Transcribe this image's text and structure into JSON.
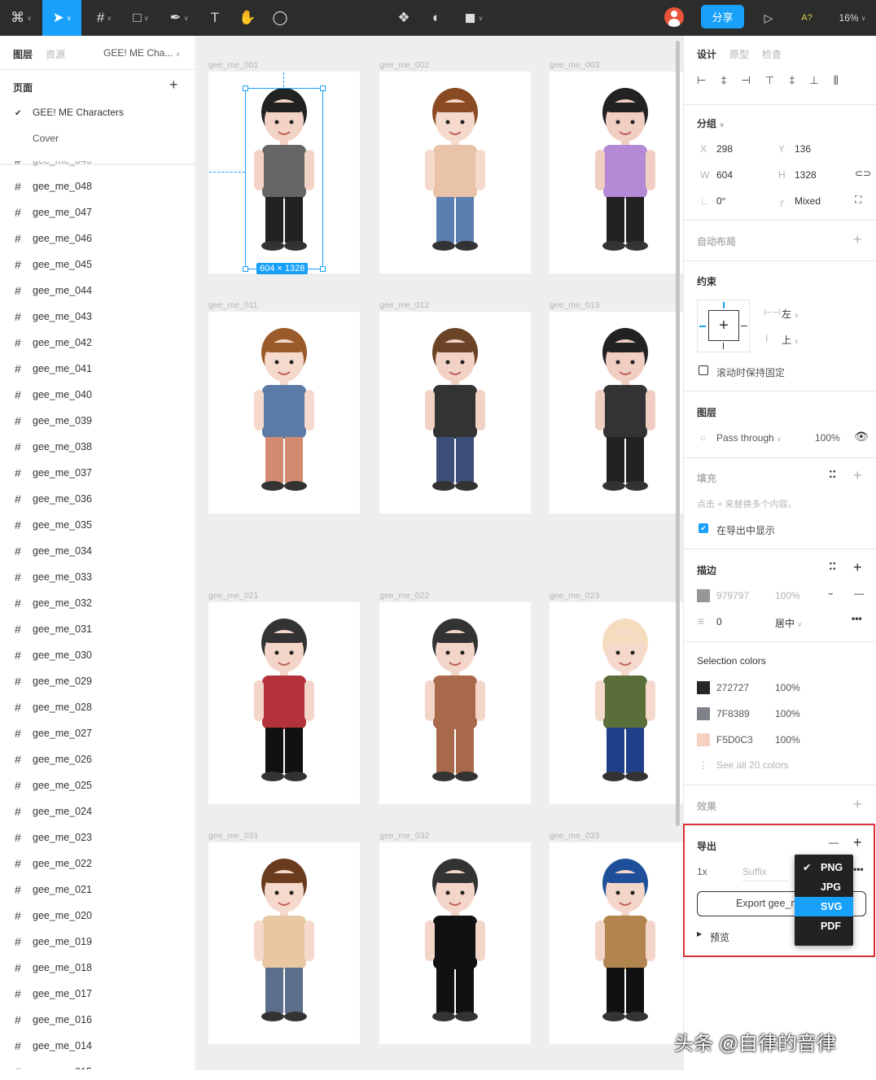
{
  "toolbar": {
    "zoom": "16%",
    "share": "分享",
    "font_warning": "A?",
    "icons": [
      "figma-menu-icon",
      "move-icon",
      "frame-icon",
      "rectangle-icon",
      "pen-icon",
      "text-icon",
      "hand-icon",
      "comment-icon",
      "component-icon",
      "mask-icon",
      "boolean-icon",
      "avatar",
      "present-icon"
    ]
  },
  "left": {
    "tab_layers": "图层",
    "tab_assets": "资源",
    "page_select": "GEE! ME Cha...",
    "pages_title": "页面",
    "pages": [
      {
        "label": "GEE! ME Characters",
        "active": true
      },
      {
        "label": "Cover",
        "active": false
      }
    ],
    "layers": [
      "gee_me_048",
      "gee_me_047",
      "gee_me_046",
      "gee_me_045",
      "gee_me_044",
      "gee_me_043",
      "gee_me_042",
      "gee_me_041",
      "gee_me_040",
      "gee_me_039",
      "gee_me_038",
      "gee_me_037",
      "gee_me_036",
      "gee_me_035",
      "gee_me_034",
      "gee_me_033",
      "gee_me_032",
      "gee_me_031",
      "gee_me_030",
      "gee_me_029",
      "gee_me_028",
      "gee_me_027",
      "gee_me_026",
      "gee_me_025",
      "gee_me_024",
      "gee_me_023",
      "gee_me_022",
      "gee_me_021",
      "gee_me_020",
      "gee_me_019",
      "gee_me_018",
      "gee_me_017",
      "gee_me_016",
      "gee_me_014"
    ]
  },
  "canvas": {
    "selection_size": "604 × 1328",
    "frames": [
      {
        "label": "gee_me_001",
        "hair": "#222",
        "top": "#666",
        "bottom": "#222",
        "skin": "#f3d3c6"
      },
      {
        "label": "gee_me_002",
        "hair": "#8a4a22",
        "top": "#e8c3a8",
        "bottom": "#5b7fb0",
        "skin": "#f5d9cc"
      },
      {
        "label": "gee_me_003",
        "hair": "#222",
        "top": "#b48ad6",
        "bottom": "#222",
        "skin": "#f0cfc2"
      },
      {
        "label": "gee_me_011",
        "hair": "#9a5a2a",
        "top": "#5b7aa6",
        "bottom": "#d28b70",
        "skin": "#f5d9cc"
      },
      {
        "label": "gee_me_012",
        "hair": "#6b4326",
        "top": "#333",
        "bottom": "#3c4f78",
        "skin": "#f1d2c4"
      },
      {
        "label": "gee_me_013",
        "hair": "#222",
        "top": "#333",
        "bottom": "#222",
        "skin": "#f0cfc2"
      },
      {
        "label": "gee_me_021",
        "hair": "#333",
        "top": "#b4333a",
        "bottom": "#111",
        "skin": "#f3d6c9"
      },
      {
        "label": "gee_me_022",
        "hair": "#333",
        "top": "#a8694a",
        "bottom": "#a8694a",
        "skin": "#f3d6c9"
      },
      {
        "label": "gee_me_023",
        "hair": "#f6dcbf",
        "top": "#5a6e3a",
        "bottom": "#1f3f8a",
        "skin": "#f5d9cc"
      },
      {
        "label": "gee_me_031",
        "hair": "#6b3b1e",
        "top": "#e9c7a2",
        "bottom": "#5b6e8a",
        "skin": "#f5d9cc"
      },
      {
        "label": "gee_me_032",
        "hair": "#333",
        "top": "#111",
        "bottom": "#111",
        "skin": "#f3d6c9"
      },
      {
        "label": "gee_me_033",
        "hair": "#1f4f9a",
        "top": "#b2854e",
        "bottom": "#111",
        "skin": "#f3d6c9"
      }
    ]
  },
  "right": {
    "tab_design": "设计",
    "tab_prototype": "原型",
    "tab_inspect": "检查",
    "group_title": "分组",
    "x_label": "X",
    "x": "298",
    "y_label": "Y",
    "y": "136",
    "w_label": "W",
    "w": "604",
    "h_label": "H",
    "h": "1328",
    "rotation": "0°",
    "radius": "Mixed",
    "auto_layout": "自动布局",
    "constraints": "约束",
    "h_constraint": "左",
    "v_constraint": "上",
    "fix_scroll": "滚动时保持固定",
    "layer_title": "图层",
    "blend": "Pass through",
    "opacity": "100%",
    "fill_title": "填充",
    "fill_hint": "点击 + 来替换多个内容。",
    "show_in_export": "在导出中显示",
    "stroke_title": "描边",
    "stroke_color": "979797",
    "stroke_opacity": "100%",
    "stroke_width": "0",
    "stroke_align": "居中",
    "selection_colors_title": "Selection colors",
    "selection_colors": [
      {
        "hex": "272727",
        "opacity": "100%",
        "color": "#272727"
      },
      {
        "hex": "7F8389",
        "opacity": "100%",
        "color": "#7F8389"
      },
      {
        "hex": "F5D0C3",
        "opacity": "100%",
        "color": "#F5D0C3"
      }
    ],
    "see_all": "See all 20 colors",
    "effects_title": "效果",
    "export_title": "导出",
    "export_scale": "1x",
    "suffix_placeholder": "Suffix",
    "export_button": "Export gee_m",
    "preview": "预览",
    "formats": [
      {
        "label": "PNG",
        "checked": true
      },
      {
        "label": "JPG"
      },
      {
        "label": "SVG",
        "highlighted": true
      },
      {
        "label": "PDF"
      }
    ]
  },
  "watermark": "头条 @自律的音律",
  "colors": {
    "accent": "#18a0fb",
    "topbar": "#2c2c2c",
    "highlight_box": "#d9303a"
  }
}
